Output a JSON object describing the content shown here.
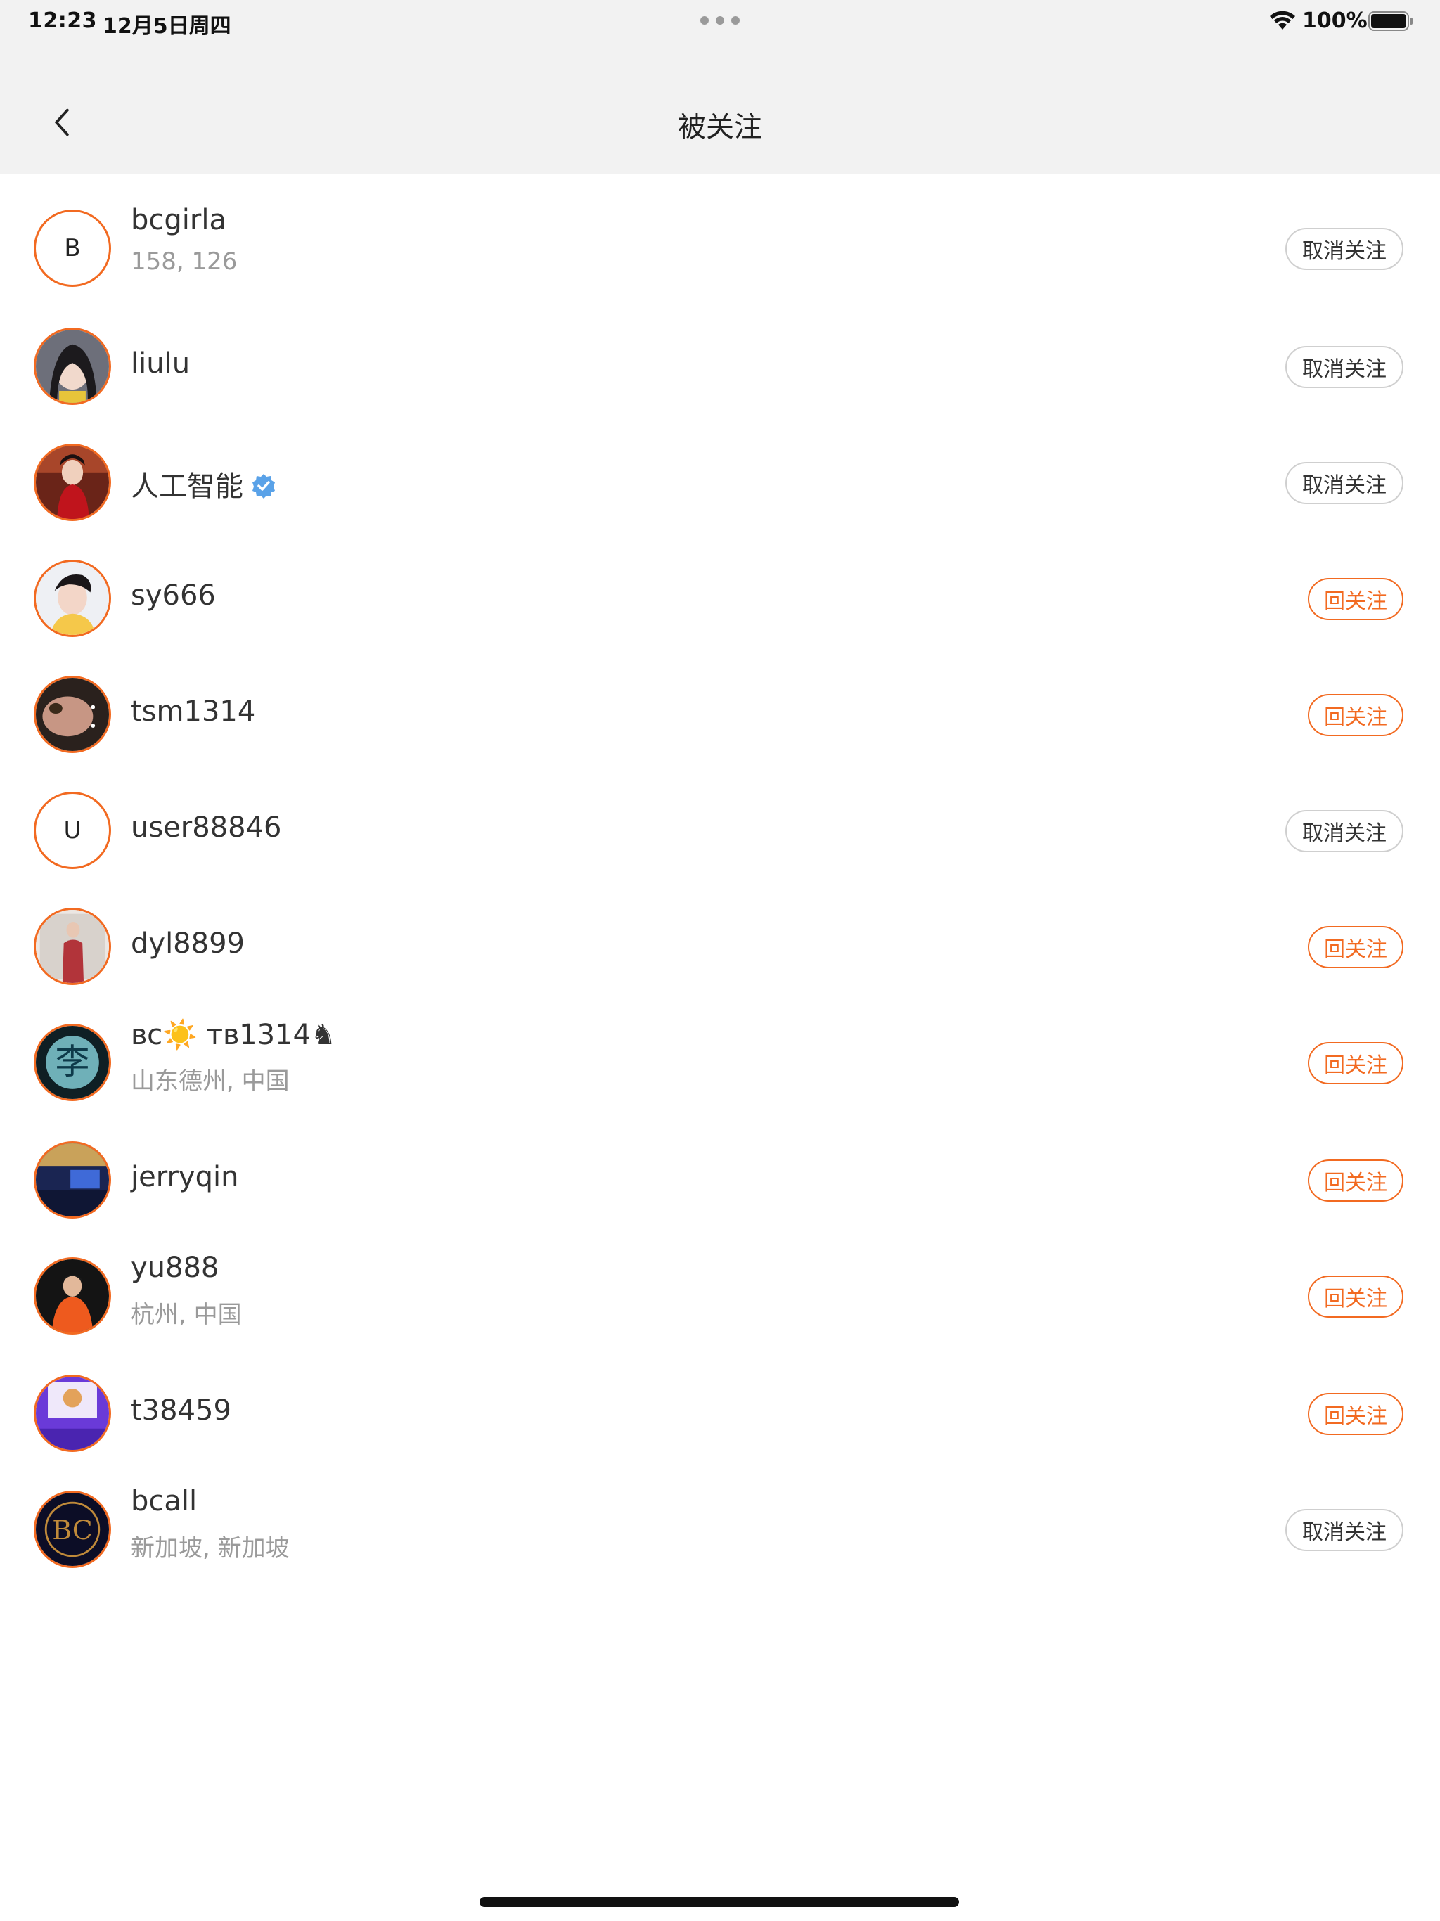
{
  "status_bar": {
    "time": "12:23",
    "date": "12月5日周四",
    "battery": "100%"
  },
  "nav": {
    "title": "被关注"
  },
  "colors": {
    "accent": "#f26a21",
    "header_bg": "#f2f2f2",
    "muted_text": "#9a9a9a"
  },
  "followers": [
    {
      "name": "bcgirla",
      "subtitle": "158, 126",
      "avatar_letter": "B",
      "verified": false,
      "button": "取消关注",
      "button_type": "unfollow"
    },
    {
      "name": "liulu",
      "subtitle": "",
      "avatar_letter": "",
      "verified": false,
      "button": "取消关注",
      "button_type": "unfollow"
    },
    {
      "name": "人工智能",
      "subtitle": "",
      "avatar_letter": "",
      "verified": true,
      "button": "取消关注",
      "button_type": "unfollow"
    },
    {
      "name": "sy666",
      "subtitle": "",
      "avatar_letter": "",
      "verified": false,
      "button": "回关注",
      "button_type": "followback"
    },
    {
      "name": "tsm1314",
      "subtitle": "",
      "avatar_letter": "",
      "verified": false,
      "button": "回关注",
      "button_type": "followback"
    },
    {
      "name": "user88846",
      "subtitle": "",
      "avatar_letter": "U",
      "verified": false,
      "button": "取消关注",
      "button_type": "unfollow"
    },
    {
      "name": "dyl8899",
      "subtitle": "",
      "avatar_letter": "",
      "verified": false,
      "button": "回关注",
      "button_type": "followback"
    },
    {
      "name": "ʙᴄ☀️ ᴛʙ1314♞",
      "subtitle": "山东德州, 中国",
      "avatar_letter": "",
      "verified": false,
      "button": "回关注",
      "button_type": "followback"
    },
    {
      "name": "jerryqin",
      "subtitle": "",
      "avatar_letter": "",
      "verified": false,
      "button": "回关注",
      "button_type": "followback"
    },
    {
      "name": "yu888",
      "subtitle": "杭州, 中国",
      "avatar_letter": "",
      "verified": false,
      "button": "回关注",
      "button_type": "followback"
    },
    {
      "name": "t38459",
      "subtitle": "",
      "avatar_letter": "",
      "verified": false,
      "button": "回关注",
      "button_type": "followback"
    },
    {
      "name": "bcall",
      "subtitle": "新加坡, 新加坡",
      "avatar_letter": "",
      "verified": false,
      "button": "取消关注",
      "button_type": "unfollow"
    }
  ]
}
